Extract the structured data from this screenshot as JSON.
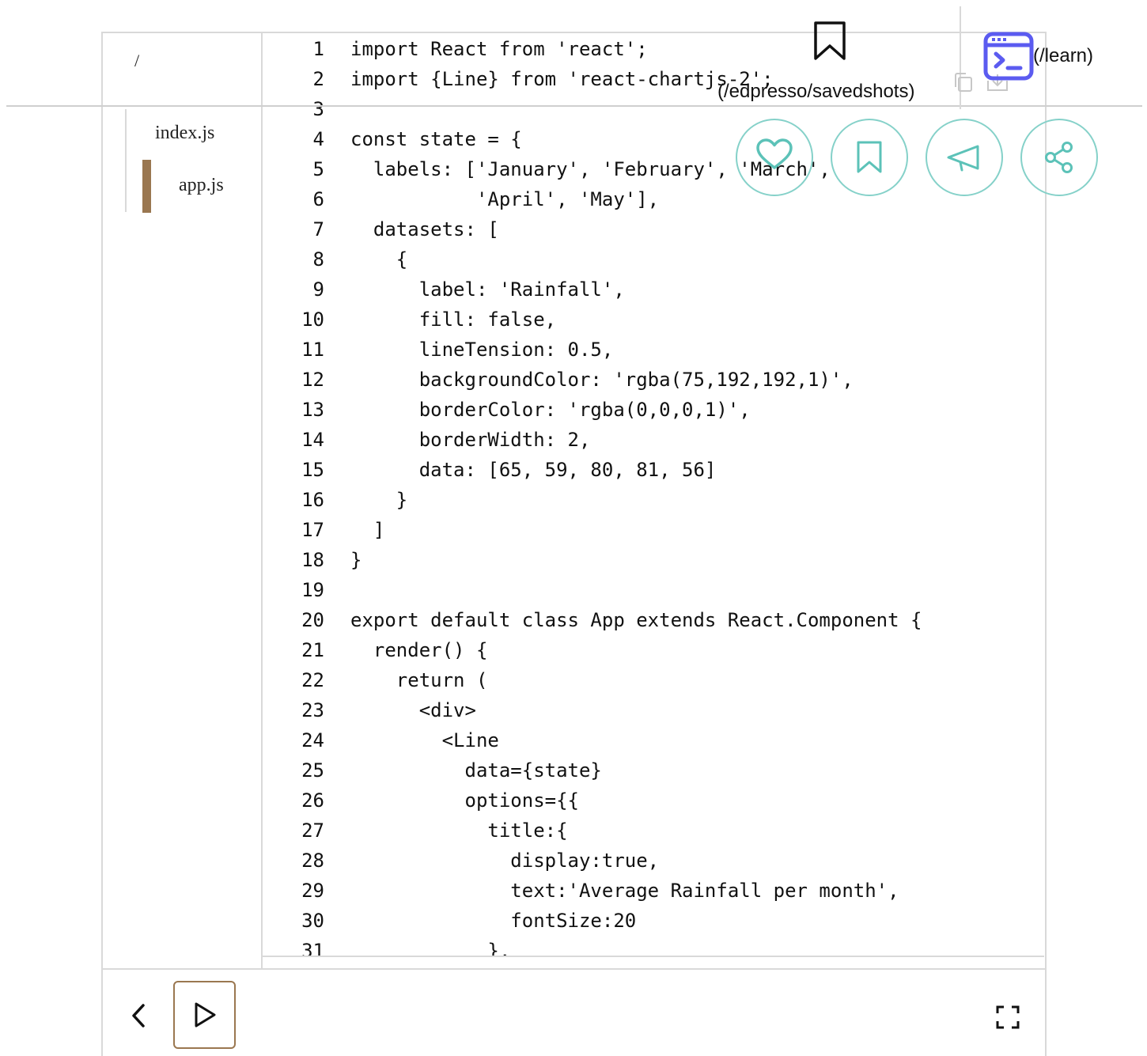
{
  "breadcrumb": "/",
  "files": [
    {
      "name": "index.js",
      "active": false
    },
    {
      "name": "app.js",
      "active": true
    }
  ],
  "code": {
    "lines": [
      {
        "n": "1",
        "text": "import React from 'react';"
      },
      {
        "n": "2",
        "text": "import {Line} from 'react-chartjs-2';"
      },
      {
        "n": "3",
        "text": ""
      },
      {
        "n": "4",
        "text": "const state = {"
      },
      {
        "n": "5",
        "text": "  labels: ['January', 'February', 'March',"
      },
      {
        "n": "6",
        "text": "           'April', 'May'],"
      },
      {
        "n": "7",
        "text": "  datasets: ["
      },
      {
        "n": "8",
        "text": "    {"
      },
      {
        "n": "9",
        "text": "      label: 'Rainfall',"
      },
      {
        "n": "10",
        "text": "      fill: false,"
      },
      {
        "n": "11",
        "text": "      lineTension: 0.5,"
      },
      {
        "n": "12",
        "text": "      backgroundColor: 'rgba(75,192,192,1)',"
      },
      {
        "n": "13",
        "text": "      borderColor: 'rgba(0,0,0,1)',"
      },
      {
        "n": "14",
        "text": "      borderWidth: 2,"
      },
      {
        "n": "15",
        "text": "      data: [65, 59, 80, 81, 56]"
      },
      {
        "n": "16",
        "text": "    }"
      },
      {
        "n": "17",
        "text": "  ]"
      },
      {
        "n": "18",
        "text": "}"
      },
      {
        "n": "19",
        "text": ""
      },
      {
        "n": "20",
        "text": "export default class App extends React.Component {"
      },
      {
        "n": "21",
        "text": "  render() {"
      },
      {
        "n": "22",
        "text": "    return ("
      },
      {
        "n": "23",
        "text": "      <div>"
      },
      {
        "n": "24",
        "text": "        <Line"
      },
      {
        "n": "25",
        "text": "          data={state}"
      },
      {
        "n": "26",
        "text": "          options={{"
      },
      {
        "n": "27",
        "text": "            title:{"
      },
      {
        "n": "28",
        "text": "              display:true,"
      },
      {
        "n": "29",
        "text": "              text:'Average Rainfall per month',"
      },
      {
        "n": "30",
        "text": "              fontSize:20"
      },
      {
        "n": "31",
        "text": "            },"
      }
    ]
  },
  "overlay": {
    "saved_link": "(/edpresso/savedshots)",
    "learn_link": "(/learn)"
  },
  "icons": {
    "bookmark": "bookmark-icon",
    "terminal": "terminal-icon",
    "copy": "copy-icon",
    "download": "download-icon",
    "heart": "heart-icon",
    "bookmark_outline": "bookmark-outline-icon",
    "megaphone": "megaphone-icon",
    "share": "share-icon",
    "back": "chevron-left-icon",
    "run": "play-icon",
    "fullscreen": "fullscreen-icon"
  },
  "colors": {
    "accent_brown": "#9a7750",
    "teal": "#5cc2b8",
    "indigo": "#5b5bf0",
    "border": "#d9d9d9"
  }
}
